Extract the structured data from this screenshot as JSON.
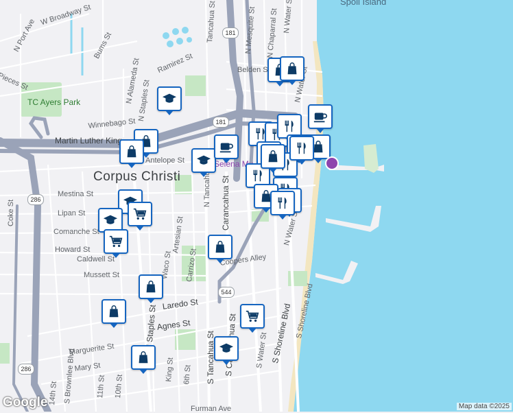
{
  "map": {
    "city_label": "Corpus Christi",
    "island_label": "Spoil Island",
    "park_label": "TC Ayers Park",
    "poi_label": "Selena Mu",
    "attribution": "Map data ©2025",
    "logo": "Google",
    "colors": {
      "water": "#8ed8f0",
      "park": "#c6e7c4",
      "highway": "#9aa3b8",
      "road": "#ffffff",
      "bg": "#f1f1f4",
      "pin_border": "#1565c0",
      "pin_icon": "#0d3b66"
    }
  },
  "shields": [
    "181",
    "181",
    "286",
    "544",
    "286"
  ],
  "streets": [
    "W Broadway St",
    "N Port Ave",
    "Bums St",
    "Ramirez St",
    "Pieces St",
    "N Alameda St",
    "N Staples St",
    "Winnebago St",
    "Martin Luther King",
    "Antelope St",
    "Mestina St",
    "Lipan St",
    "Comanche St",
    "Howard St",
    "Caldwell St",
    "Mussett St",
    "Laredo St",
    "Agnes St",
    "Marguerite St",
    "Mary St",
    "N Tancahua St",
    "Carancahua St",
    "Artesian St",
    "Carrizo St",
    "Waco St",
    "Coke St",
    "Coopers Alley",
    "S Tancahua St",
    "S Carancahua St",
    "King St",
    "6th St",
    "10th St",
    "11th St",
    "14th St",
    "S Brownlee Blvd",
    "S Water St",
    "S Shoreline Blvd",
    "N Water St",
    "N Mesquite St",
    "N Chaparral St",
    "Belden St",
    "Furman Ave",
    "Tancahua St"
  ],
  "markers": [
    {
      "icon": "shopping-bag"
    },
    {
      "icon": "shopping-bag"
    },
    {
      "icon": "graduation-cap"
    },
    {
      "icon": "shopping-bag"
    },
    {
      "icon": "shopping-bag"
    },
    {
      "icon": "graduation-cap"
    },
    {
      "icon": "coffee-cup"
    },
    {
      "icon": "graduation-cap"
    },
    {
      "icon": "shopping-cart"
    },
    {
      "icon": "graduation-cap"
    },
    {
      "icon": "shopping-cart"
    },
    {
      "icon": "shopping-bag"
    },
    {
      "icon": "shopping-bag"
    },
    {
      "icon": "shopping-bag"
    },
    {
      "icon": "shopping-bag"
    },
    {
      "icon": "graduation-cap"
    },
    {
      "icon": "shopping-cart"
    },
    {
      "icon": "coffee-cup"
    },
    {
      "icon": "utensils"
    },
    {
      "icon": "utensils"
    },
    {
      "icon": "utensils"
    },
    {
      "icon": "utensils"
    },
    {
      "icon": "utensils"
    },
    {
      "icon": "utensils"
    },
    {
      "icon": "shopping-bag"
    },
    {
      "icon": "utensils"
    },
    {
      "icon": "utensils"
    },
    {
      "icon": "utensils"
    },
    {
      "icon": "shopping-bag"
    },
    {
      "icon": "utensils"
    },
    {
      "icon": "utensils"
    },
    {
      "icon": "shopping-bag"
    }
  ]
}
